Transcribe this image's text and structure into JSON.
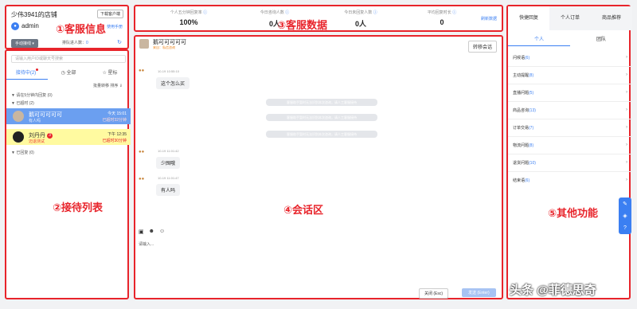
{
  "info": {
    "store_name": "少伟3941的店铺",
    "download_button": "下载客户端",
    "username": "admin",
    "manual_link": "使用手册",
    "status_select": "手动接线 ▾",
    "queue_label": "排队进人数：",
    "queue_count": "0",
    "annotation": "①客服信息"
  },
  "list": {
    "search_placeholder": "请输入用户ID或聊天号搜索",
    "tabs": [
      {
        "label": "接待中(2)"
      },
      {
        "label": "全部"
      },
      {
        "label": "星标"
      }
    ],
    "batch_label": "批量转移  排序 ⇓",
    "group_timeout": "▼ 请在5分钟内回复 (0)",
    "group_over": "▼ 已超时 (2)",
    "group_replied": "▼ 已回复 (0)",
    "conversations": [
      {
        "name": "鹅可可可可可",
        "sub": "有人吗",
        "time": "今天 15:01",
        "wait": "已超时32分钟"
      },
      {
        "name": "刘丹丹",
        "badge": "3",
        "sub": "迈退测试",
        "time": "下午 12:35",
        "wait": "已超时30分钟"
      }
    ],
    "annotation": "②接待列表"
  },
  "stats": {
    "items": [
      {
        "label": "个人五分钟回复率",
        "value": "100%"
      },
      {
        "label": "今日咨询人数",
        "value": "0人"
      },
      {
        "label": "今日未回复人数",
        "value": "0人"
      },
      {
        "label": "平均回复时长",
        "value": "0"
      }
    ],
    "refresh_label": "刷新数据",
    "annotation": "③客服数据"
  },
  "chat": {
    "name": "鹅可可可可可",
    "source": "来自：私信咨询",
    "transfer_button": "转移会话",
    "messages": [
      {
        "time": "10-19 10:55:10",
        "text": "这个怎么买"
      },
      {
        "time": "10-19 11:01:42",
        "text": "少囤哦"
      },
      {
        "time": "10-19 11:01:47",
        "text": "有人吗"
      }
    ],
    "system_notes": [
      "客服助手暂时无法识别本次咨询，请人工客服接待",
      "客服助手暂时无法识别本次咨询，请人工客服接待",
      "客服助手暂时无法识别本次咨询，请人工客服接待"
    ],
    "input_placeholder": "请输入...",
    "close_button": "关闭 (Esc)",
    "send_button": "发送 (Enter)",
    "annotation": "④会话区"
  },
  "side": {
    "tabs": [
      {
        "label": "快捷回复"
      },
      {
        "label": "个人订单"
      },
      {
        "label": "商品推荐"
      }
    ],
    "segments": [
      {
        "label": "个人"
      },
      {
        "label": "团队"
      }
    ],
    "categories": [
      {
        "name": "问候语",
        "count": "(6)"
      },
      {
        "name": "主动提醒",
        "count": "(8)"
      },
      {
        "name": "直播问题",
        "count": "(5)"
      },
      {
        "name": "商品咨询",
        "count": "(13)"
      },
      {
        "name": "订单交易",
        "count": "(7)"
      },
      {
        "name": "物流问题",
        "count": "(8)"
      },
      {
        "name": "退货问题",
        "count": "(10)"
      },
      {
        "name": "结束语",
        "count": "(6)"
      }
    ],
    "annotation": "⑤其他功能"
  },
  "watermark": "头条 @菲德思奇"
}
